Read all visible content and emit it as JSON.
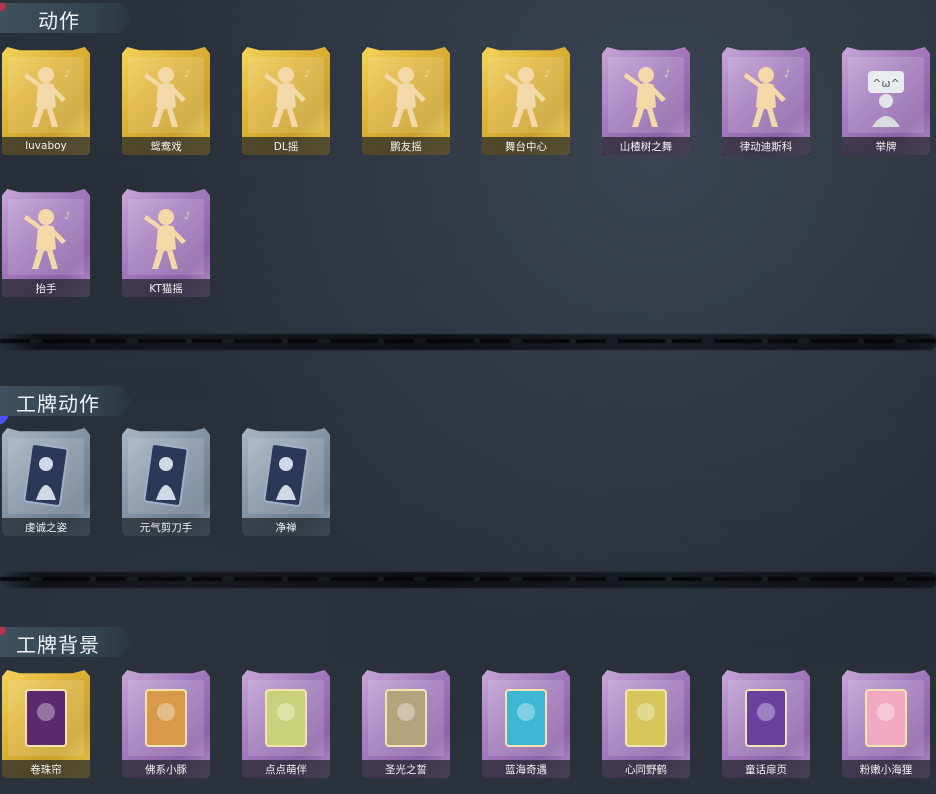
{
  "sections": [
    {
      "title": "动作",
      "items": [
        {
          "label": "luvaboy",
          "rarity": "gold",
          "icon": "dance-pose-icon"
        },
        {
          "label": "鸳鸯戏",
          "rarity": "gold",
          "icon": "dance-pose-icon"
        },
        {
          "label": "DL摇",
          "rarity": "gold",
          "icon": "dance-pose-icon"
        },
        {
          "label": "鹏友摇",
          "rarity": "gold",
          "icon": "dance-pose-icon"
        },
        {
          "label": "舞台中心",
          "rarity": "gold",
          "icon": "dance-pose-icon"
        },
        {
          "label": "山楂树之舞",
          "rarity": "purple",
          "icon": "dance-pose-icon"
        },
        {
          "label": "律动迪斯科",
          "rarity": "purple",
          "icon": "dance-pose-icon"
        },
        {
          "label": "举牌",
          "rarity": "purple",
          "icon": "sign-holding-icon"
        },
        {
          "label": "抬手",
          "rarity": "purple",
          "icon": "raise-hand-icon"
        },
        {
          "label": "KT猫摇",
          "rarity": "purple",
          "icon": "dance-pose-icon"
        }
      ]
    },
    {
      "title": "工牌动作",
      "items": [
        {
          "label": "虔诚之姿",
          "rarity": "blue",
          "icon": "badge-pose-icon"
        },
        {
          "label": "元气剪刀手",
          "rarity": "blue",
          "icon": "badge-pose-icon"
        },
        {
          "label": "净禅",
          "rarity": "blue",
          "icon": "badge-pose-icon"
        }
      ]
    },
    {
      "title": "工牌背景",
      "items": [
        {
          "label": "卷珠帘",
          "rarity": "gold",
          "icon": "badge-background-icon",
          "tint": "#5b2a6e"
        },
        {
          "label": "佛系小豚",
          "rarity": "purple",
          "icon": "badge-background-icon",
          "tint": "#d89a4a"
        },
        {
          "label": "点点萌伴",
          "rarity": "purple",
          "icon": "badge-background-icon",
          "tint": "#c9d27a"
        },
        {
          "label": "圣光之誓",
          "rarity": "purple",
          "icon": "badge-background-icon",
          "tint": "#b7a27e"
        },
        {
          "label": "蓝海奇遇",
          "rarity": "purple",
          "icon": "badge-background-icon",
          "tint": "#3fb6d4"
        },
        {
          "label": "心同野鹤",
          "rarity": "purple",
          "icon": "badge-background-icon",
          "tint": "#d6c55a"
        },
        {
          "label": "童话扉页",
          "rarity": "purple",
          "icon": "badge-background-icon",
          "tint": "#6a3f9e"
        },
        {
          "label": "粉嫩小海狸",
          "rarity": "purple",
          "icon": "badge-background-icon",
          "tint": "#f1a9c2"
        }
      ]
    }
  ],
  "colors": {
    "gold": "#e0b43a",
    "purple": "#a47bbd",
    "blue": "#8393a5",
    "figure": "#f4d9a8",
    "badge_figure": "#cfd9e6"
  }
}
